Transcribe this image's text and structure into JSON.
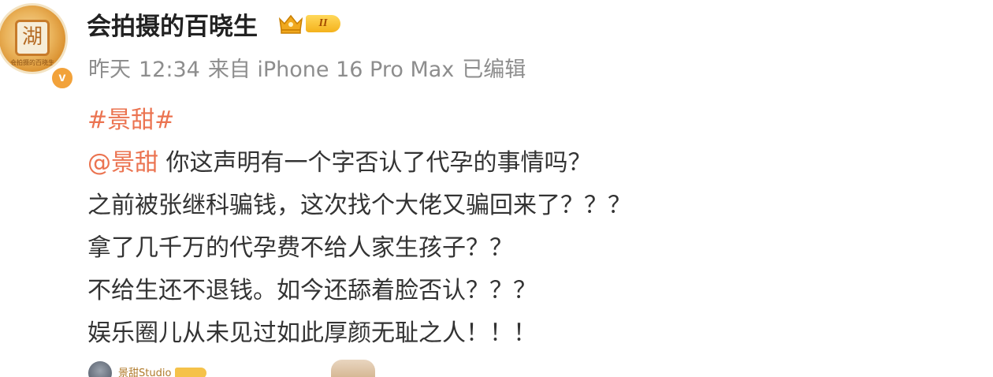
{
  "user": {
    "name": "会拍摄的百晓生",
    "avatar_glyph": "湖",
    "avatar_caption": "会拍摄的百晓生",
    "verify_mark": "v",
    "level": "II"
  },
  "meta": {
    "date": "昨天",
    "time": "12:34",
    "source": "来自 iPhone 16 Pro Max",
    "edited": "已编辑"
  },
  "content": {
    "topic": "#景甜#",
    "mention": "@景甜",
    "line1_rest": " 你这声明有一个字否认了代孕的事情吗？",
    "line2": "之前被张继科骗钱，这次找个大佬又骗回来了？？？",
    "line3": "拿了几千万的代孕费不给人家生孩子？？",
    "line4": "不给生还不退钱。如今还舔着脸否认？？？",
    "line5": "娱乐圈儿从未见过如此厚颜无耻之人！！！"
  },
  "bottom": {
    "left_label": "景甜Studio"
  },
  "colors": {
    "link": "#eb7350",
    "meta": "#8d8d8d",
    "text": "#333333",
    "name": "#222222"
  }
}
